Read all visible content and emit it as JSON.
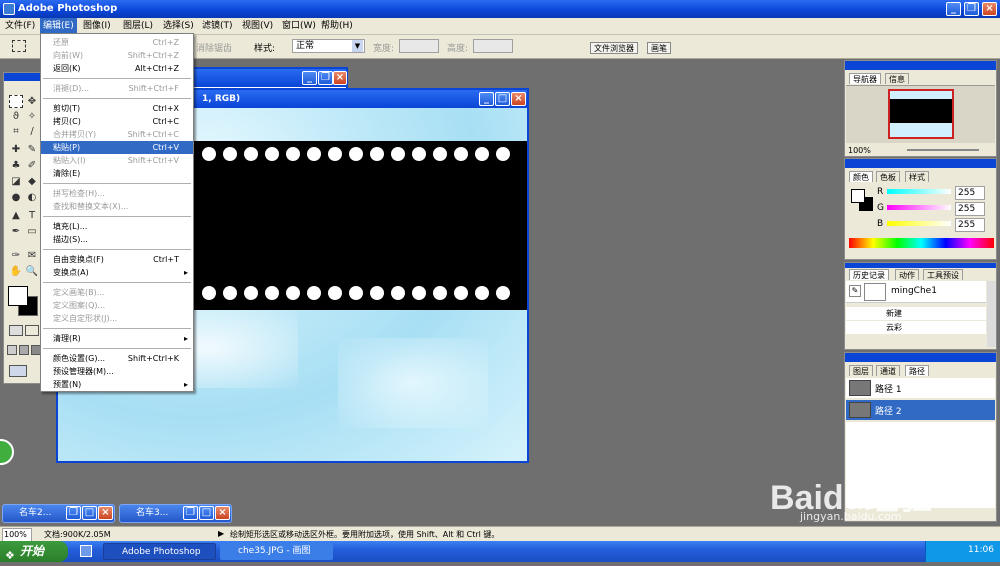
{
  "app": {
    "title": "Adobe Photoshop"
  },
  "menubar": [
    {
      "label": "文件(F)",
      "active": false
    },
    {
      "label": "编辑(E)",
      "active": true
    },
    {
      "label": "图像(I)",
      "active": false
    },
    {
      "label": "图层(L)",
      "active": false
    },
    {
      "label": "选择(S)",
      "active": false
    },
    {
      "label": "滤镜(T)",
      "active": false
    },
    {
      "label": "视图(V)",
      "active": false
    },
    {
      "label": "窗口(W)",
      "active": false
    },
    {
      "label": "帮助(H)",
      "active": false
    }
  ],
  "options": {
    "feather_partial": "消除锯齿",
    "style_label": "样式:",
    "style_value": "正常",
    "width_label": "宽度:",
    "height_label": "高度:",
    "tab_browser": "文件浏览器",
    "tab_brush": "画笔"
  },
  "edit_menu": {
    "items": [
      {
        "label": "还原",
        "shortcut": "Ctrl+Z",
        "disabled": true
      },
      {
        "label": "向前(W)",
        "shortcut": "Shift+Ctrl+Z",
        "disabled": true
      },
      {
        "label": "返回(K)",
        "shortcut": "Alt+Ctrl+Z",
        "disabled": false
      },
      {
        "sep": true
      },
      {
        "label": "消褪(D)...",
        "shortcut": "Shift+Ctrl+F",
        "disabled": true
      },
      {
        "sep": true
      },
      {
        "label": "剪切(T)",
        "shortcut": "Ctrl+X",
        "disabled": false
      },
      {
        "label": "拷贝(C)",
        "shortcut": "Ctrl+C",
        "disabled": false
      },
      {
        "label": "合并拷贝(Y)",
        "shortcut": "Shift+Ctrl+C",
        "disabled": true
      },
      {
        "label": "粘贴(P)",
        "shortcut": "Ctrl+V",
        "disabled": false,
        "selected": true
      },
      {
        "label": "粘贴入(I)",
        "shortcut": "Shift+Ctrl+V",
        "disabled": true
      },
      {
        "label": "清除(E)",
        "shortcut": "",
        "disabled": false
      },
      {
        "sep": true
      },
      {
        "label": "拼写检查(H)...",
        "shortcut": "",
        "disabled": true
      },
      {
        "label": "查找和替换文本(X)...",
        "shortcut": "",
        "disabled": true
      },
      {
        "sep": true
      },
      {
        "label": "填充(L)...",
        "shortcut": "",
        "disabled": false
      },
      {
        "label": "描边(S)...",
        "shortcut": "",
        "disabled": false
      },
      {
        "sep": true
      },
      {
        "label": "自由变换点(F)",
        "shortcut": "Ctrl+T",
        "disabled": false
      },
      {
        "label": "变换点(A)",
        "shortcut": "",
        "disabled": false,
        "submenu": true
      },
      {
        "sep": true
      },
      {
        "label": "定义画笔(B)...",
        "shortcut": "",
        "disabled": true
      },
      {
        "label": "定义图案(Q)...",
        "shortcut": "",
        "disabled": true
      },
      {
        "label": "定义自定形状(J)...",
        "shortcut": "",
        "disabled": true
      },
      {
        "sep": true
      },
      {
        "label": "清理(R)",
        "shortcut": "",
        "disabled": false,
        "submenu": true
      },
      {
        "sep": true
      },
      {
        "label": "颜色设置(G)...",
        "shortcut": "Shift+Ctrl+K",
        "disabled": false
      },
      {
        "label": "预设管理器(M)...",
        "shortcut": "",
        "disabled": false
      },
      {
        "label": "预置(N)",
        "shortcut": "",
        "disabled": false,
        "submenu": true
      }
    ]
  },
  "document": {
    "title_fragment": "1, RGB)"
  },
  "navigator": {
    "tabs": [
      "导航器",
      "信息"
    ],
    "zoom": "100%"
  },
  "color": {
    "tabs": [
      "颜色",
      "色板",
      "样式"
    ],
    "r_label": "R",
    "g_label": "G",
    "b_label": "B",
    "r": "255",
    "g": "255",
    "b": "255"
  },
  "history": {
    "tabs": [
      "历史记录",
      "动作",
      "工具预设"
    ],
    "snapshot": "mingChe1",
    "items": [
      "新建",
      "云彩"
    ]
  },
  "layers": {
    "tabs": [
      "图层",
      "通道",
      "路径"
    ],
    "paths": [
      {
        "label": "路径 1",
        "selected": false
      },
      {
        "label": "路径 2",
        "selected": true
      }
    ]
  },
  "minimized": [
    "名车2...",
    "名车3..."
  ],
  "status": {
    "zoom": "100%",
    "doc": "文档:900K/2.05M",
    "hint": "绘制矩形选区或移动选区外框。要用附加选项，使用 Shift、Alt 和 Ctrl 键。"
  },
  "taskbar": {
    "start": "开始",
    "tasks": [
      "Adobe Photoshop",
      "che35.JPG - 画图"
    ],
    "time": "11:06"
  },
  "watermark": {
    "brand": "Baidu经验",
    "url": "jingyan.baidu.com"
  },
  "colors": {
    "titlebar": "#0a45d6",
    "menu_select": "#316ac5",
    "panel": "#ece9d8"
  }
}
